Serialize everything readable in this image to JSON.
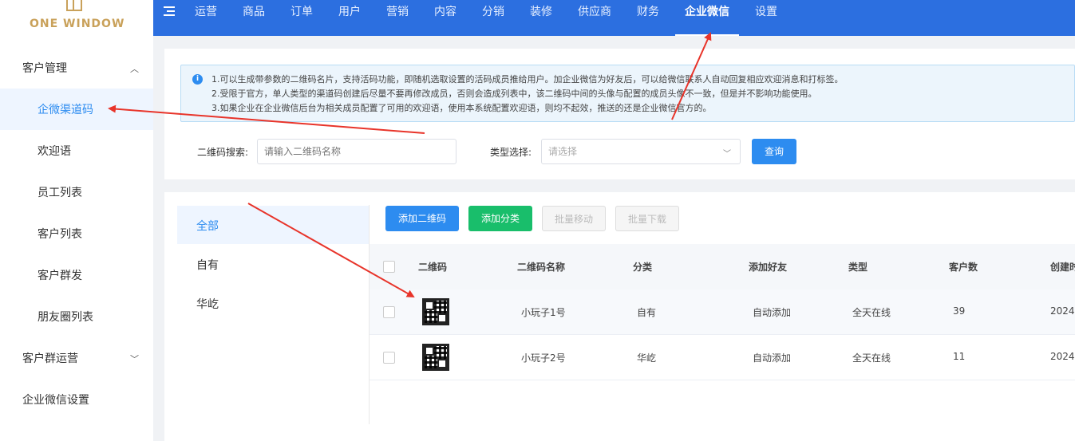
{
  "brand": {
    "name": "ONE WINDOW"
  },
  "nav": [
    "运营",
    "商品",
    "订单",
    "用户",
    "营销",
    "内容",
    "分销",
    "装修",
    "供应商",
    "财务",
    "企业微信",
    "设置"
  ],
  "nav_active": "企业微信",
  "sidebar": {
    "group1": "客户管理",
    "items": [
      "企微渠道码",
      "欢迎语",
      "员工列表",
      "客户列表",
      "客户群发",
      "朋友圈列表"
    ],
    "group2": "客户群运营",
    "group3": "企业微信设置"
  },
  "notice": {
    "lines": [
      "1.可以生成带参数的二维码名片，支持活码功能，即随机选取设置的活码成员推给用户。加企业微信为好友后，可以给微信联系人自动回复相应欢迎消息和打标签。",
      "2.受限于官方，单人类型的渠道码创建后尽量不要再修改成员，否则会造成列表中，该二维码中间的头像与配置的成员头像不一致，但是并不影响功能使用。",
      "3.如果企业在企业微信后台为相关成员配置了可用的欢迎语，使用本系统配置欢迎语，则均不起效，推送的还是企业微信官方的。"
    ]
  },
  "filters": {
    "search_label": "二维码搜索:",
    "search_placeholder": "请输入二维码名称",
    "type_label": "类型选择:",
    "type_placeholder": "请选择",
    "query_button": "查询"
  },
  "categories": [
    "全部",
    "自有",
    "华屹"
  ],
  "toolbar": {
    "add_qr": "添加二维码",
    "add_category": "添加分类",
    "batch_move": "批量移动",
    "batch_download": "批量下载"
  },
  "table": {
    "headers": [
      "二维码",
      "二维码名称",
      "分类",
      "添加好友",
      "类型",
      "客户数",
      "创建时"
    ],
    "rows": [
      {
        "name": "小玩子1号",
        "category": "自有",
        "add_friend": "自动添加",
        "type": "全天在线",
        "customers": "39",
        "created": "2024"
      },
      {
        "name": "小玩子2号",
        "category": "华屹",
        "add_friend": "自动添加",
        "type": "全天在线",
        "customers": "11",
        "created": "2024"
      }
    ]
  },
  "colors": {
    "primary": "#2d8cf0",
    "topbar": "#2c6fe0",
    "success": "#19be6b",
    "annotation": "#e8342a"
  }
}
